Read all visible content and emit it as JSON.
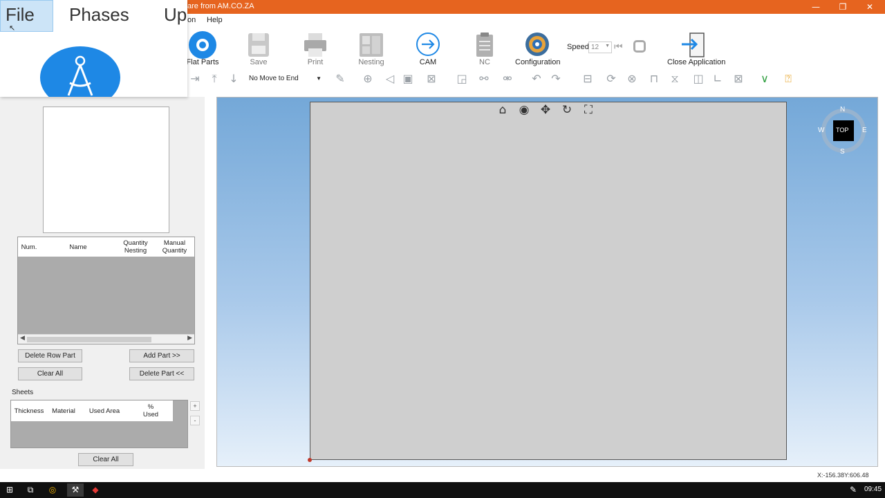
{
  "window": {
    "title": "are from AM.CO.ZA",
    "minimize_glyph": "—",
    "restore_glyph": "❐",
    "close_glyph": "✕"
  },
  "menu": {
    "partial_item": "on",
    "help": "Help"
  },
  "file_menu": {
    "file": "File",
    "phases": "Phases",
    "partial": "Up"
  },
  "toolbar": {
    "flat_parts": "Flat Parts",
    "save": "Save",
    "print": "Print",
    "nesting": "Nesting",
    "cam": "CAM",
    "nc": "NC",
    "configuration": "Configuration",
    "speed_label": "Speed",
    "speed_value": "12",
    "close_application": "Close Application",
    "move_mode": "No Move to End"
  },
  "parts_table": {
    "columns": [
      "Num.",
      "Name",
      "Quantity Nesting",
      "Manual Quantity"
    ]
  },
  "buttons": {
    "delete_row_part": "Delete Row Part",
    "add_part": "Add Part >>",
    "clear_all": "Clear All",
    "delete_part": "Delete Part <<",
    "clear_all_sheets": "Clear All",
    "plus": "+",
    "minus": "-"
  },
  "sheets": {
    "label": "Sheets",
    "columns": [
      "Thickness",
      "Material",
      "Used Area",
      "% Used"
    ]
  },
  "navcube": {
    "n": "N",
    "s": "S",
    "e": "E",
    "w": "W",
    "face": "TOP"
  },
  "status": {
    "coords": "X:-156.38Y:606.48"
  },
  "taskbar": {
    "time": "09:45"
  },
  "colors": {
    "titlebar": "#e6641f",
    "accent_blue": "#1e88e5",
    "sheet": "#cfcfcf"
  }
}
